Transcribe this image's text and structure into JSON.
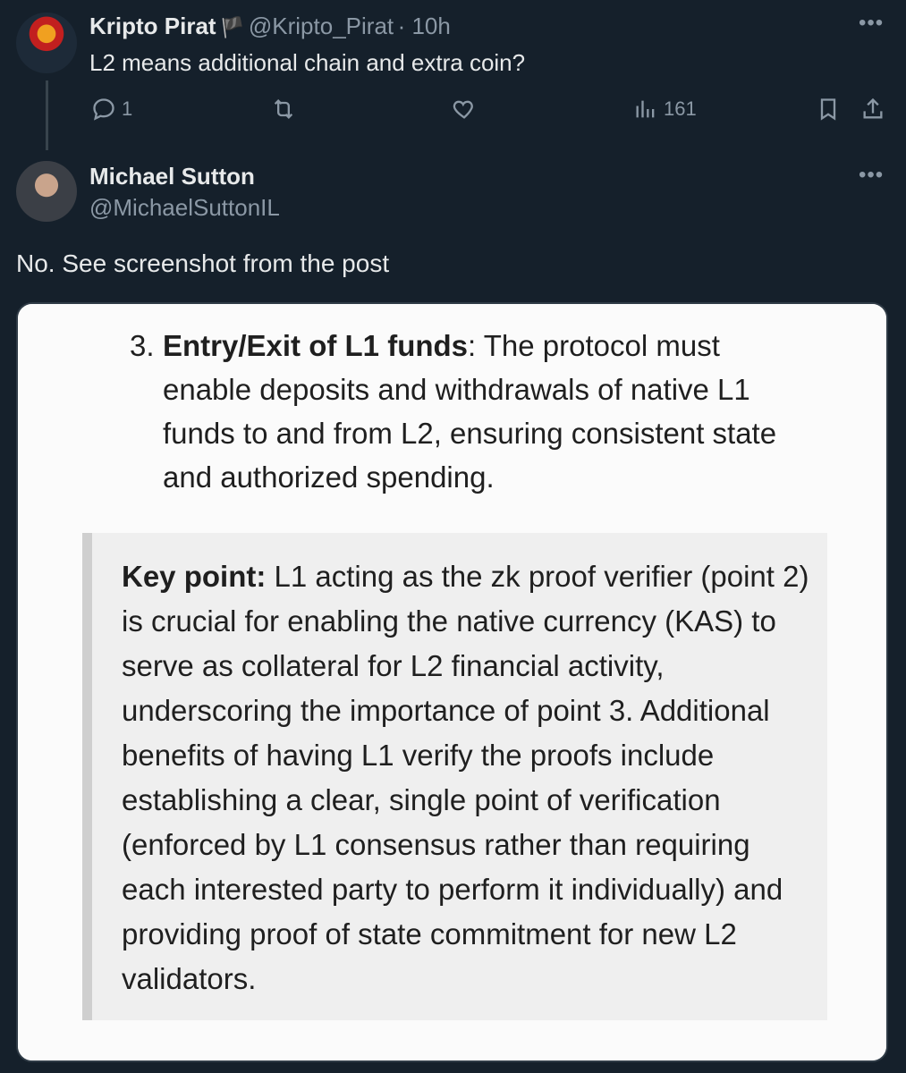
{
  "reply": {
    "author_name": "Kripto Pirat",
    "author_badge": "🏴",
    "author_handle": "@Kripto_Pirat",
    "time": "· 10h",
    "text": "L2 means additional chain and extra coin?",
    "actions": {
      "replies": "1",
      "retweets": "",
      "likes": "",
      "views": "161"
    }
  },
  "tweet": {
    "author_name": "Michael Sutton",
    "author_handle": "@MichaelSuttonIL",
    "text": "No. See screenshot from the post"
  },
  "screenshot": {
    "item_number": "3.",
    "item_title": "Entry/Exit of L1 funds",
    "item_text": ": The protocol must enable deposits and withdrawals of native L1 funds to and from L2, ensuring consistent state and authorized spending.",
    "key_label": "Key point:",
    "key_text": " L1 acting as the zk proof verifier (point 2) is crucial for enabling the native currency (KAS) to serve as collateral for L2 financial activity, underscoring the importance of point 3. Additional benefits of having L1 verify the proofs include establishing a clear, single point of verification (enforced by L1 consensus rather than requiring each interested party to perform it individually) and providing proof of state commitment for new L2 validators."
  },
  "icons": [
    "more-icon",
    "reply-icon",
    "retweet-icon",
    "like-icon",
    "views-icon",
    "bookmark-icon",
    "share-icon"
  ],
  "colors": {
    "background": "#15202b",
    "text": "#e7e9ea",
    "muted": "#8b98a5"
  }
}
